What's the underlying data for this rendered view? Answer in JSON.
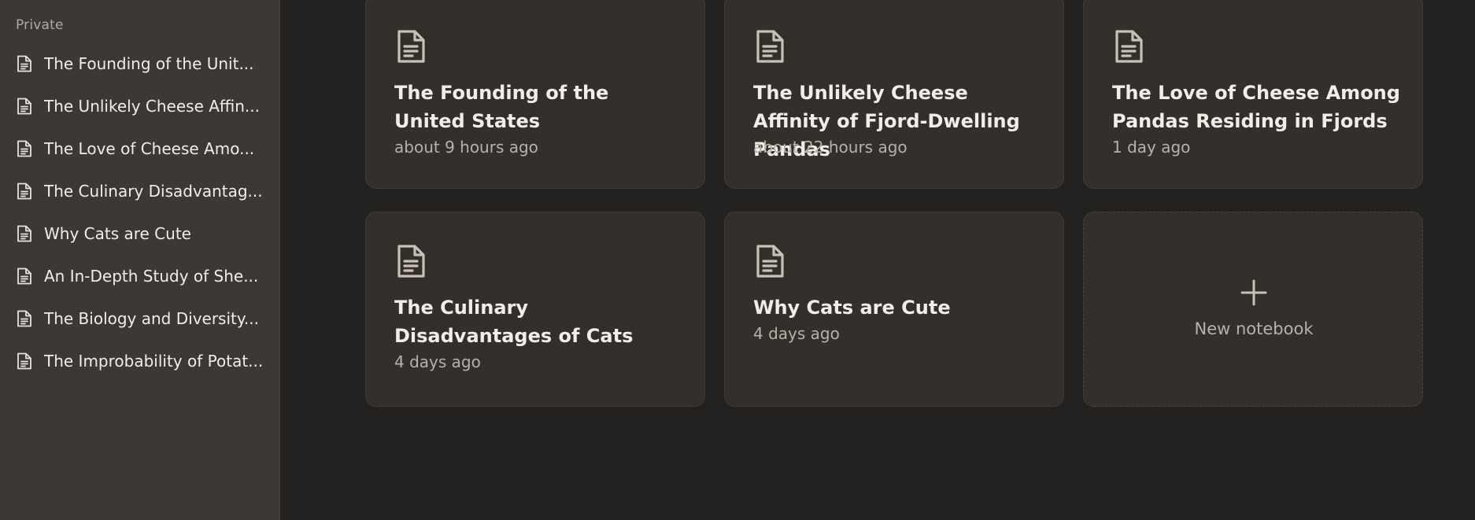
{
  "sidebar": {
    "section_label": "Private",
    "items": [
      {
        "label": "The Founding of the Unit...",
        "icon": "document-icon"
      },
      {
        "label": "The Unlikely Cheese Affin...",
        "icon": "document-icon"
      },
      {
        "label": "The Love of Cheese Amo...",
        "icon": "document-icon"
      },
      {
        "label": "The Culinary Disadvantag...",
        "icon": "document-icon"
      },
      {
        "label": "Why Cats are Cute",
        "icon": "document-icon"
      },
      {
        "label": "An In-Depth Study of She...",
        "icon": "document-icon"
      },
      {
        "label": "The Biology and Diversity...",
        "icon": "document-icon"
      },
      {
        "label": "The Improbability of Potat...",
        "icon": "document-icon"
      }
    ]
  },
  "notebooks": [
    {
      "title": "The Founding of the United States",
      "time": "about 9 hours ago"
    },
    {
      "title": "The Unlikely Cheese Affinity of Fjord-Dwelling Pandas",
      "time": "about 22 hours ago"
    },
    {
      "title": "The Love of Cheese Among Pandas Residing in Fjords",
      "time": "1 day ago"
    },
    {
      "title": "The Culinary Disadvantages of Cats",
      "time": "4 days ago"
    },
    {
      "title": "Why Cats are Cute",
      "time": "4 days ago"
    }
  ],
  "new_notebook": {
    "label": "New notebook",
    "icon": "plus-icon"
  },
  "colors": {
    "sidebar_bg": "#3e3834",
    "main_bg": "#242220",
    "card_bg": "#33302c",
    "text_primary": "#f1ede7",
    "text_secondary": "#b8b1a9",
    "icon": "#c9c1b6"
  }
}
